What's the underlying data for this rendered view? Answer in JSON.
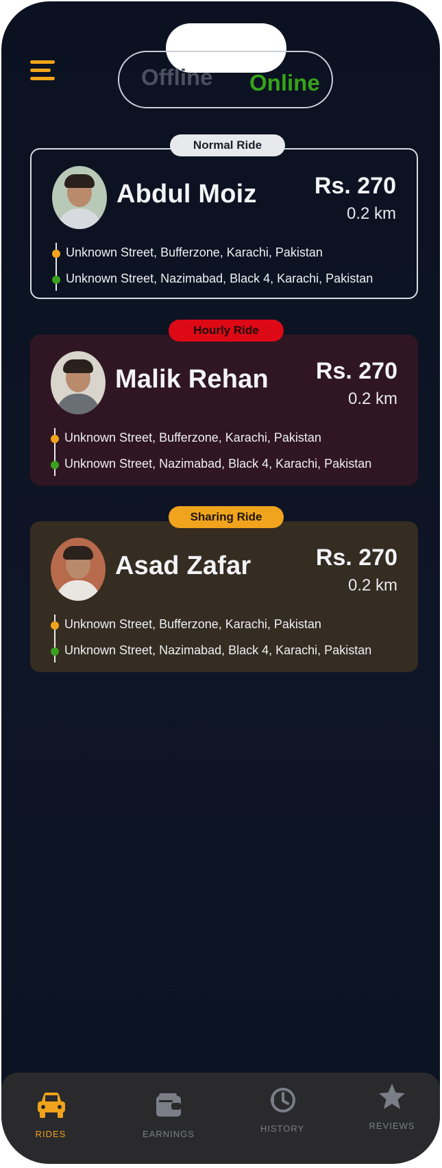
{
  "header": {
    "menu_icon": "menu-icon",
    "status_toggle": {
      "offline_label": "Offline",
      "online_label": "Online",
      "selected": "Online"
    }
  },
  "rides": [
    {
      "type_label": "Normal Ride",
      "name": "Abdul Moiz",
      "price": "Rs. 270",
      "distance": "0.2 km",
      "pickup": "Unknown Street, Bufferzone, Karachi, Pakistan",
      "dropoff": "Unknown Street, Nazimabad, Black 4, Karachi, Pakistan"
    },
    {
      "type_label": "Hourly Ride",
      "name": "Malik Rehan",
      "price": "Rs. 270",
      "distance": "0.2 km",
      "pickup": "Unknown Street, Bufferzone, Karachi, Pakistan",
      "dropoff": "Unknown Street, Nazimabad, Black 4, Karachi, Pakistan"
    },
    {
      "type_label": "Sharing Ride",
      "name": "Asad Zafar",
      "price": "Rs. 270",
      "distance": "0.2 km",
      "pickup": "Unknown Street, Bufferzone, Karachi, Pakistan",
      "dropoff": "Unknown Street, Nazimabad, Black 4, Karachi, Pakistan"
    }
  ],
  "tabs": [
    {
      "label": "RIDES",
      "icon": "car-icon",
      "active": true
    },
    {
      "label": "EARNINGS",
      "icon": "wallet-icon",
      "active": false
    },
    {
      "label": "HISTORY",
      "icon": "history-icon",
      "active": false
    },
    {
      "label": "REVIEWS",
      "icon": "star-icon",
      "active": false
    }
  ],
  "colors": {
    "accent": "#f0a31c",
    "online": "#36a31a",
    "hourly_badge": "#dd0a16",
    "background": "#0e1526"
  }
}
